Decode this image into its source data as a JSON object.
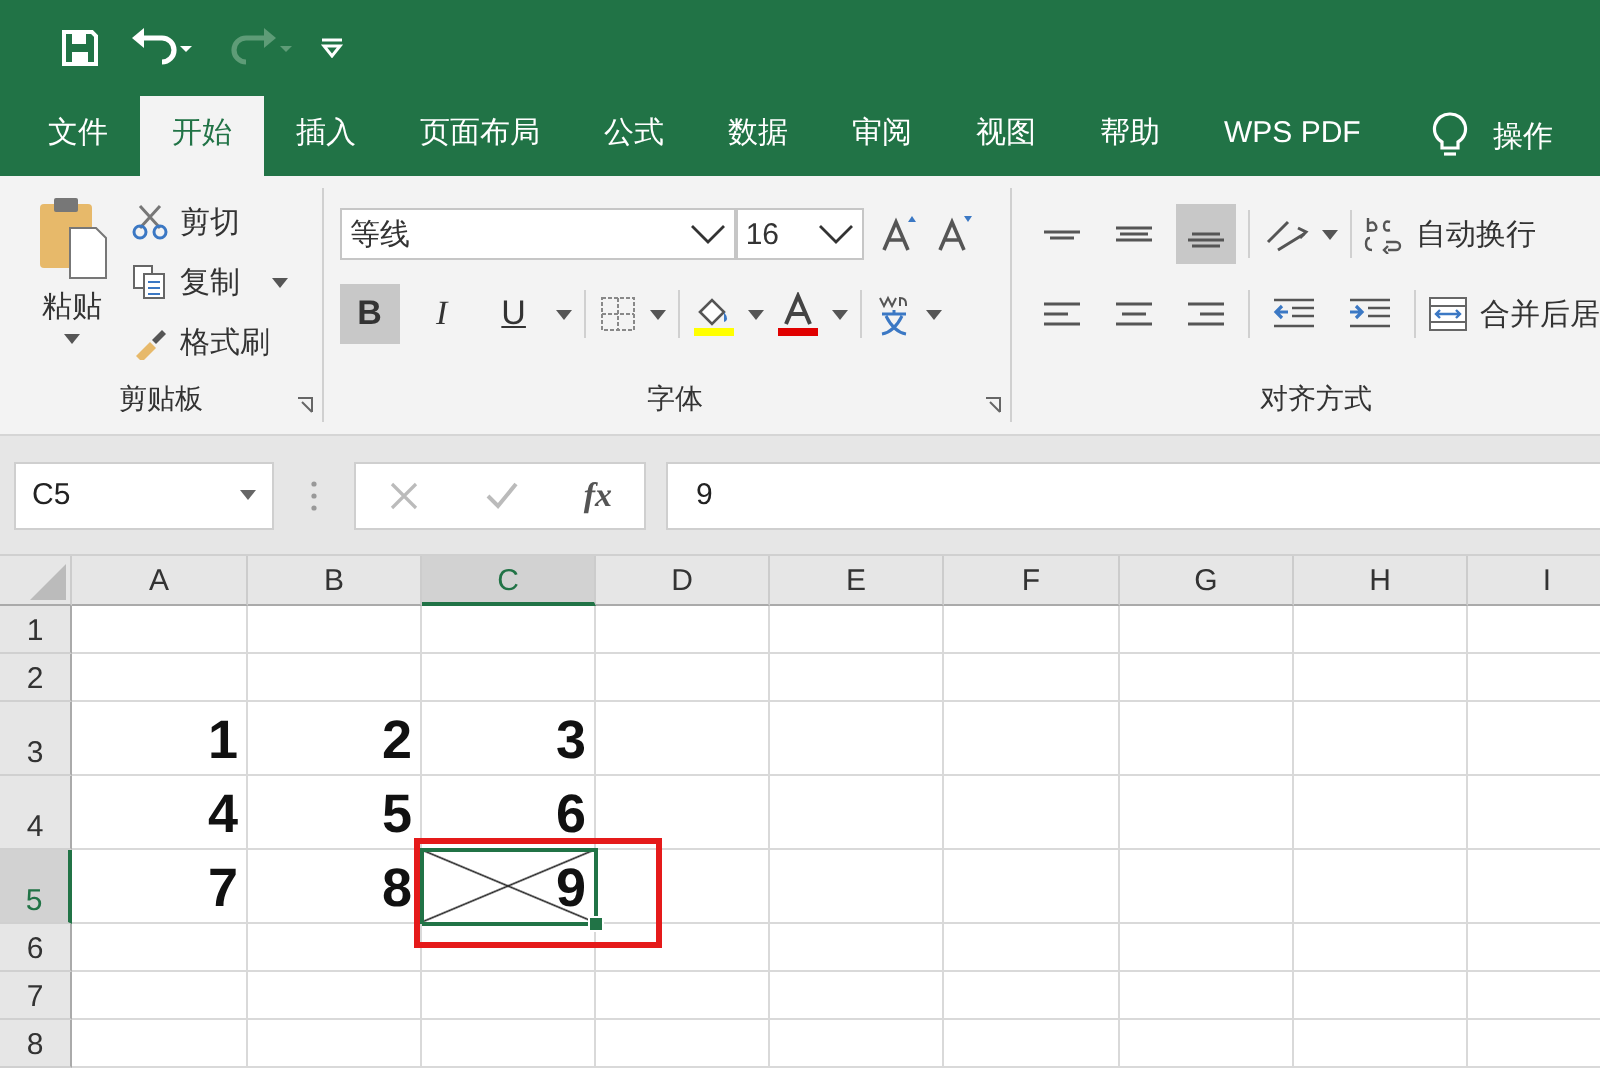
{
  "tabs": [
    {
      "label": "文件",
      "selected": false
    },
    {
      "label": "开始",
      "selected": true
    },
    {
      "label": "插入",
      "selected": false
    },
    {
      "label": "页面布局",
      "selected": false
    },
    {
      "label": "公式",
      "selected": false
    },
    {
      "label": "数据",
      "selected": false
    },
    {
      "label": "审阅",
      "selected": false
    },
    {
      "label": "视图",
      "selected": false
    },
    {
      "label": "帮助",
      "selected": false
    },
    {
      "label": "WPS PDF",
      "selected": false
    }
  ],
  "tell_me": "操作",
  "clipboard": {
    "paste": "粘贴",
    "cut": "剪切",
    "copy": "复制",
    "format_painter": "格式刷",
    "label": "剪贴板"
  },
  "font": {
    "name": "等线",
    "size": "16",
    "styles": [
      {
        "kind": "bold",
        "label": "B",
        "on": true
      },
      {
        "kind": "italic",
        "label": "I",
        "on": false
      },
      {
        "kind": "underline",
        "label": "U",
        "on": false
      }
    ],
    "label": "字体"
  },
  "alignment": {
    "top": false,
    "middle": false,
    "bottom": true,
    "wrap": "自动换行",
    "merge": "合并后居",
    "label": "对齐方式"
  },
  "formula_bar": {
    "name_box": "C5",
    "fx": "fx",
    "value": "9"
  },
  "sheet": {
    "columns": [
      {
        "label": "A",
        "selected": false
      },
      {
        "label": "B",
        "selected": false
      },
      {
        "label": "C",
        "selected": true
      },
      {
        "label": "D",
        "selected": false
      },
      {
        "label": "E",
        "selected": false
      },
      {
        "label": "F",
        "selected": false
      },
      {
        "label": "G",
        "selected": false
      },
      {
        "label": "H",
        "selected": false
      },
      {
        "label": "I",
        "selected": false
      }
    ],
    "rows": [
      {
        "label": "1",
        "selected": false,
        "cells": []
      },
      {
        "label": "2",
        "selected": false,
        "cells": []
      },
      {
        "label": "3",
        "selected": false,
        "cells": [
          {
            "value": "1",
            "diagonal": false,
            "highlighted": false
          },
          {
            "value": "2",
            "diagonal": false,
            "highlighted": false
          },
          {
            "value": "3",
            "diagonal": false,
            "highlighted": false
          }
        ]
      },
      {
        "label": "4",
        "selected": false,
        "cells": [
          {
            "value": "4",
            "diagonal": false,
            "highlighted": false
          },
          {
            "value": "5",
            "diagonal": false,
            "highlighted": false
          },
          {
            "value": "6",
            "diagonal": false,
            "highlighted": false
          }
        ]
      },
      {
        "label": "5",
        "selected": true,
        "cells": [
          {
            "value": "7",
            "diagonal": false,
            "highlighted": false
          },
          {
            "value": "8",
            "diagonal": false,
            "highlighted": false
          },
          {
            "value": "9",
            "diagonal": true,
            "highlighted": true
          }
        ]
      },
      {
        "label": "6",
        "selected": false,
        "cells": []
      },
      {
        "label": "7",
        "selected": false,
        "cells": []
      },
      {
        "label": "8",
        "selected": false,
        "cells": []
      }
    ]
  }
}
